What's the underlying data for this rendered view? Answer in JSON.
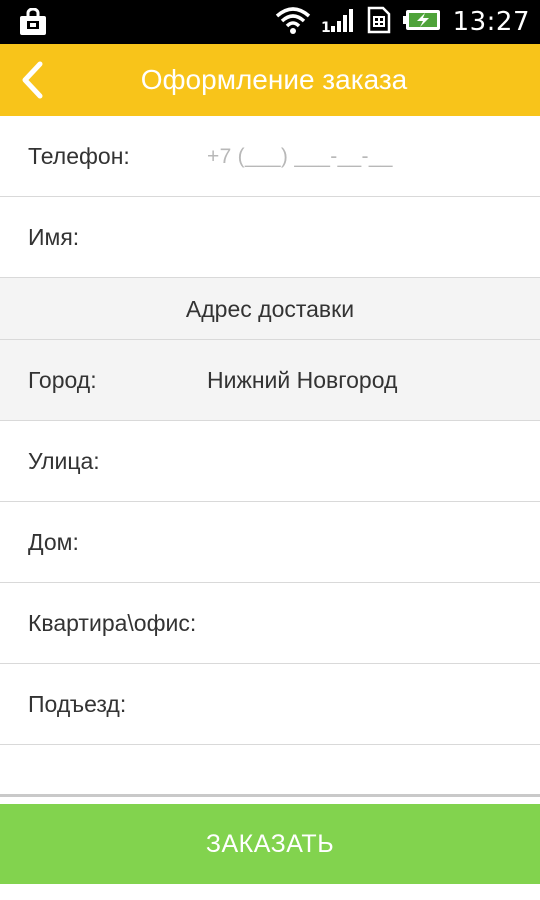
{
  "status_bar": {
    "time": "13:27",
    "icons": [
      "shopping-bag-icon",
      "wifi-icon",
      "signal-icon",
      "sim-icon",
      "battery-charging-icon"
    ]
  },
  "app_bar": {
    "title": "Оформление заказа",
    "back_icon": "chevron-left-icon",
    "color": "#f8c41a"
  },
  "form": {
    "phone": {
      "label": "Телефон:",
      "placeholder": "+7 (___) ___-__-__"
    },
    "name": {
      "label": "Имя:",
      "value": ""
    },
    "section_title": "Адрес доставки",
    "city": {
      "label": "Город:",
      "value": "Нижний Новгород"
    },
    "street": {
      "label": "Улица:",
      "value": ""
    },
    "house": {
      "label": "Дом:",
      "value": ""
    },
    "apartment": {
      "label": "Квартира\\офис:",
      "value": ""
    },
    "entrance": {
      "label": "Подъезд:",
      "value": ""
    }
  },
  "order_button": {
    "label": "ЗАКАЗАТЬ",
    "color": "#82d34e"
  }
}
